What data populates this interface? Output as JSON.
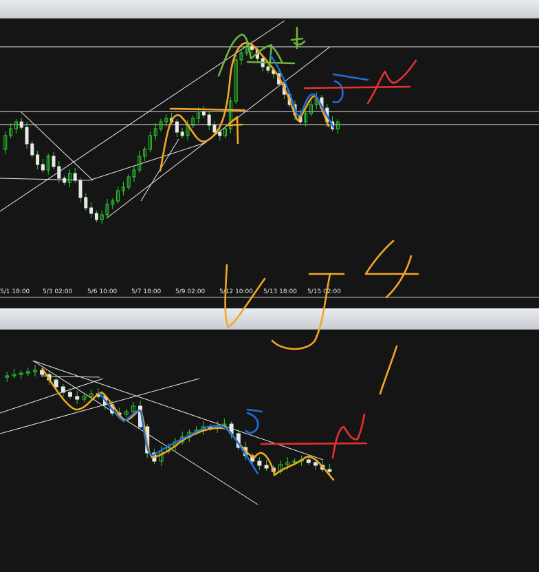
{
  "window": {
    "panes": [
      "chart-upper",
      "chart-lower"
    ],
    "background": "#151515",
    "header_color": "#d6dadf"
  },
  "colors": {
    "bull_candle": "#2ed12e",
    "bear_candle": "#e8e8e8",
    "trendline": "#e8e8e8",
    "ink_orange": "#f2a623",
    "ink_blue": "#1d6fd6",
    "ink_red": "#e53232",
    "ink_green": "#6fb33a"
  },
  "upper_chart": {
    "time_axis": {
      "labels": [
        "5/1 18:00",
        "5/3 02:00",
        "5/6 10:00",
        "5/7 18:00",
        "5/9 02:00",
        "5/12 10:00",
        "5/13 18:00",
        "5/15 02:00"
      ]
    },
    "annotations": [
      "4",
      "5",
      "4"
    ]
  },
  "lower_chart": {
    "annotations": [
      "5"
    ]
  },
  "handwriting": {
    "text": "UJ",
    "wave_numbers": [
      "4",
      "1"
    ]
  }
}
